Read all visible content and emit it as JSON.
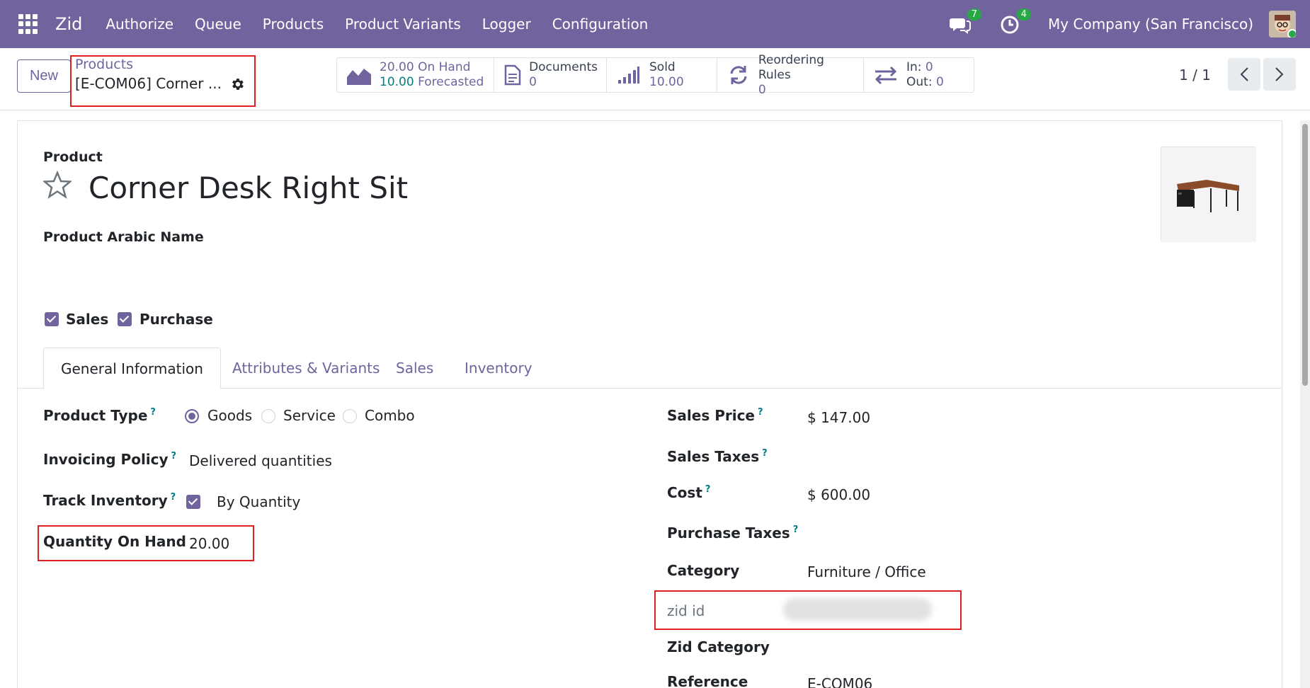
{
  "navbar": {
    "brand": "Zid",
    "menu": [
      "Authorize",
      "Queue",
      "Products",
      "Product Variants",
      "Logger",
      "Configuration"
    ],
    "messages_count": "7",
    "activities_count": "4",
    "company": "My Company (San Francisco)"
  },
  "control_panel": {
    "new_label": "New",
    "breadcrumb_parent": "Products",
    "breadcrumb_current": "[E-COM06] Corner ...",
    "stats": {
      "on_hand_value": "20.00",
      "on_hand_label": "On Hand",
      "forecast_value": "10.00",
      "forecast_label": "Forecasted",
      "documents_label": "Documents",
      "documents_value": "0",
      "sold_label": "Sold",
      "sold_value": "10.00",
      "reorder_label": "Reordering Rules",
      "reorder_value": "0",
      "in_label": "In:",
      "in_value": "0",
      "out_label": "Out:",
      "out_value": "0"
    },
    "pager": "1 / 1"
  },
  "form": {
    "product_label": "Product",
    "product_name": "Corner Desk Right Sit",
    "arabic_name_label": "Product Arabic Name",
    "sales_checkbox_label": "Sales",
    "purchase_checkbox_label": "Purchase",
    "tabs": [
      "General Information",
      "Attributes & Variants",
      "Sales",
      "Inventory"
    ],
    "left": {
      "product_type_label": "Product Type",
      "product_type_options": [
        "Goods",
        "Service",
        "Combo"
      ],
      "invoicing_policy_label": "Invoicing Policy",
      "invoicing_policy_value": "Delivered quantities",
      "track_inventory_label": "Track Inventory",
      "track_inventory_value": "By Quantity",
      "qty_on_hand_label": "Quantity On Hand",
      "qty_on_hand_value": "20.00"
    },
    "right": {
      "sales_price_label": "Sales Price",
      "sales_price_value": "$ 147.00",
      "sales_taxes_label": "Sales Taxes",
      "cost_label": "Cost",
      "cost_value": "$ 600.00",
      "purchase_taxes_label": "Purchase Taxes",
      "category_label": "Category",
      "category_value": "Furniture / Office",
      "zid_id_label": "zid id",
      "zid_category_label": "Zid Category",
      "reference_label": "Reference",
      "reference_value": "E-COM06"
    },
    "help_mark": "?"
  },
  "colors": {
    "navbar": "#71639e",
    "accent": "#71639e",
    "teal": "#017e84",
    "highlight_box": "#e02020",
    "badge": "#28a745"
  }
}
